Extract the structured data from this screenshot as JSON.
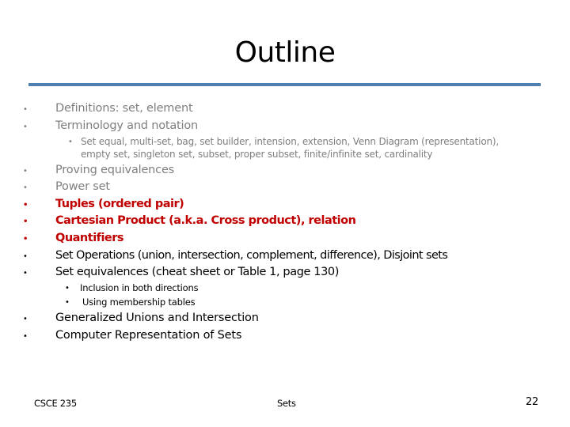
{
  "slide": {
    "title": "Outline",
    "accent_rule_color": "#4f7faf",
    "colors": {
      "completed": "#7f7f7f",
      "highlight": "#c00000",
      "upcoming": "#000000"
    },
    "bullet_glyph": "•",
    "items": [
      {
        "text": "Definitions: set, element",
        "level": 1,
        "state": "completed"
      },
      {
        "text": "Terminology and notation",
        "level": 1,
        "state": "completed"
      },
      {
        "text_lines": [
          "Set equal, multi-set, bag, set builder, intension, extension, Venn Diagram (representation),",
          "empty set, singleton set, subset, proper subset, finite/infinite set, cardinality"
        ],
        "level": 2,
        "state": "completed"
      },
      {
        "text": "Proving equivalences",
        "level": 1,
        "state": "completed"
      },
      {
        "text": "Power set",
        "level": 1,
        "state": "completed"
      },
      {
        "text": "Tuples (ordered pair)",
        "level": 1,
        "state": "highlight"
      },
      {
        "text": "Cartesian Product (a.k.a. Cross product), relation",
        "level": 1,
        "state": "highlight"
      },
      {
        "text": "Quantifiers",
        "level": 1,
        "state": "highlight"
      },
      {
        "text": "Set Operations (union, intersection, complement, difference), Disjoint sets",
        "level": 1,
        "state": "upcoming"
      },
      {
        "text": "Set equivalences (cheat sheet or Table 1, page 130)",
        "level": 1,
        "state": "upcoming"
      },
      {
        "text": "Inclusion in both directions",
        "level": 2,
        "state": "upcoming"
      },
      {
        "text": "Using membership tables",
        "level": 2,
        "state": "upcoming"
      },
      {
        "text": "Generalized Unions and Intersection",
        "level": 1,
        "state": "upcoming"
      },
      {
        "text": "Computer Representation of Sets",
        "level": 1,
        "state": "upcoming"
      }
    ]
  },
  "footer": {
    "course": "CSCE 235",
    "topic": "Sets",
    "page_number": "22"
  }
}
